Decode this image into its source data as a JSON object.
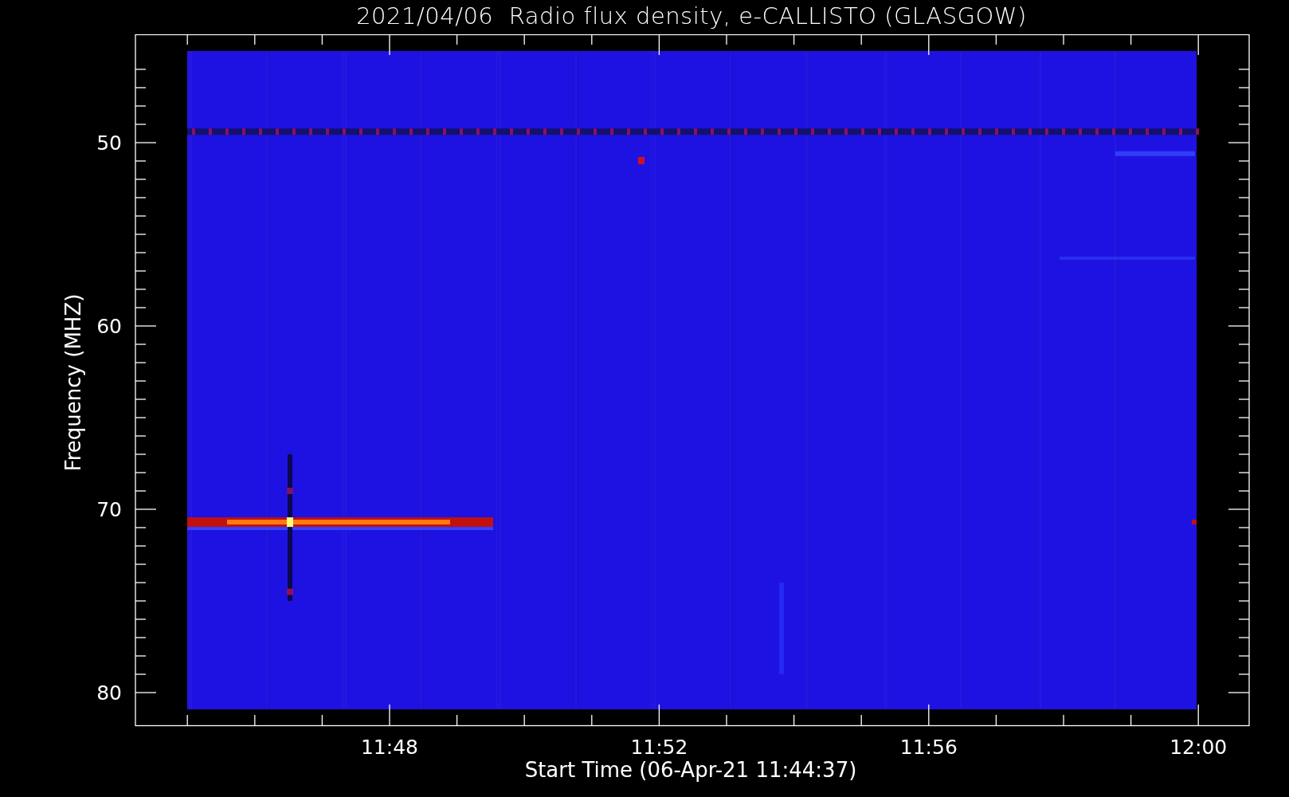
{
  "plot": {
    "title": "2021/04/06  Radio flux density, e-CALLISTO (GLASGOW)",
    "ylabel": "Frequency (MHZ)",
    "xlabel": "Start Time (06-Apr-21 11:44:37)",
    "yticks": [
      "50",
      "60",
      "70",
      "80"
    ],
    "xticks": [
      "11:48",
      "11:52",
      "11:56",
      "12:00"
    ]
  }
}
